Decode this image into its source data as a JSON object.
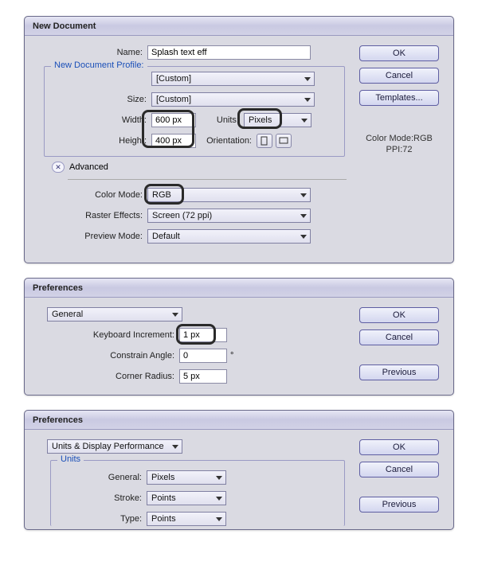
{
  "newdoc": {
    "title": "New Document",
    "name_label": "Name:",
    "name_value": "Splash text eff",
    "profile_label": "New Document Profile:",
    "profile_value": "[Custom]",
    "size_label": "Size:",
    "size_value": "[Custom]",
    "width_label": "Width:",
    "width_value": "600 px",
    "units_label": "Units:",
    "units_value": "Pixels",
    "height_label": "Height:",
    "height_value": "400 px",
    "orientation_label": "Orientation:",
    "advanced_label": "Advanced",
    "color_mode_label": "Color Mode:",
    "color_mode_value": "RGB",
    "raster_label": "Raster Effects:",
    "raster_value": "Screen (72 ppi)",
    "preview_label": "Preview Mode:",
    "preview_value": "Default",
    "ok": "OK",
    "cancel": "Cancel",
    "templates": "Templates...",
    "info_line1": "Color Mode:RGB",
    "info_line2": "PPI:72"
  },
  "prefs1": {
    "title": "Preferences",
    "category": "General",
    "kbd_label": "Keyboard Increment:",
    "kbd_value": "1 px",
    "angle_label": "Constrain Angle:",
    "angle_value": "0",
    "angle_unit": "°",
    "radius_label": "Corner Radius:",
    "radius_value": "5 px",
    "ok": "OK",
    "cancel": "Cancel",
    "previous": "Previous"
  },
  "prefs2": {
    "title": "Preferences",
    "category": "Units & Display Performance",
    "units_group": "Units",
    "general_label": "General:",
    "general_value": "Pixels",
    "stroke_label": "Stroke:",
    "stroke_value": "Points",
    "type_label": "Type:",
    "type_value": "Points",
    "ok": "OK",
    "cancel": "Cancel",
    "previous": "Previous"
  }
}
